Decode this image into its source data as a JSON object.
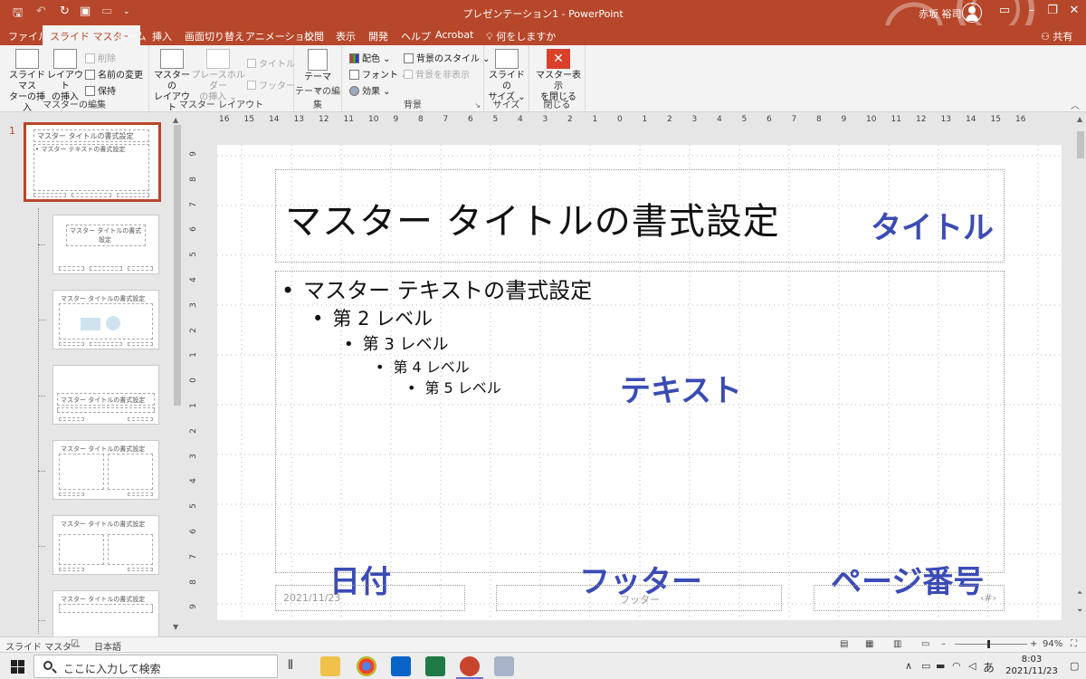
{
  "window": {
    "title": "プレゼンテーション1  -  PowerPoint",
    "user_name": "赤坂 裕司"
  },
  "tabs": [
    "ファイル",
    "スライド マスター",
    "ホーム",
    "挿入",
    "画面切り替え",
    "アニメーション",
    "校閲",
    "表示",
    "開発",
    "ヘルプ",
    "Acrobat"
  ],
  "tell_me": "何をしますか",
  "share": "共有",
  "ribbon": {
    "groups": {
      "master_edit": "マスターの編集",
      "master_layout": "マスター レイアウト",
      "theme_edit": "テーマの編集",
      "background": "背景",
      "size": "サイズ",
      "close": "閉じる"
    },
    "insert_slide_master": [
      "スライド マス",
      "ターの挿入"
    ],
    "insert_layout": [
      "レイアウト",
      "の挿入"
    ],
    "delete": "削除",
    "rename": "名前の変更",
    "preserve": "保持",
    "master_layout_btn": [
      "マスターの",
      "レイアウト"
    ],
    "insert_placeholder": [
      "プレースホルダー",
      "の挿入 ⌄"
    ],
    "title_check": "タイトル",
    "footer_check": "フッター",
    "themes": [
      "テーマ",
      "⌄"
    ],
    "colors": "配色 ⌄",
    "fonts": "フォント ⌄",
    "effects": "効果 ⌄",
    "background_styles": "背景のスタイル ⌄",
    "hide_background": "背景を非表示",
    "slide_size": [
      "スライドの",
      "サイズ ⌄"
    ],
    "close_master": [
      "マスター表示",
      "を閉じる"
    ]
  },
  "thumbnails": {
    "slide_number": "1",
    "master_title": "マスター タイトルの書式設定",
    "master_text": "• マスター テキストの書式設定",
    "layout2_title": "マスター タイトルの書式",
    "layout2_title2": "設定",
    "layout3_title": "マスター タイトルの書式設定",
    "layout4_title": "マスター タイトルの書式設定",
    "layout5_title": "マスター タイトルの書式設定",
    "layout6_title": "マスター タイトルの書式設定",
    "layout7_title": "マスター タイトルの書式設定"
  },
  "ruler": {
    "h_ticks": [
      "16",
      "15",
      "14",
      "13",
      "12",
      "11",
      "10",
      "9",
      "8",
      "7",
      "6",
      "5",
      "4",
      "3",
      "2",
      "1",
      "0",
      "1",
      "2",
      "3",
      "4",
      "5",
      "6",
      "7",
      "8",
      "9",
      "10",
      "11",
      "12",
      "13",
      "14",
      "15",
      "16"
    ],
    "v_ticks": [
      "9",
      "8",
      "7",
      "6",
      "5",
      "4",
      "3",
      "2",
      "1",
      "0",
      "1",
      "2",
      "3",
      "4",
      "5",
      "6",
      "7",
      "8",
      "9"
    ]
  },
  "slide": {
    "title": "マスター タイトルの書式設定",
    "bullets": [
      "マスター テキストの書式設定",
      "第 2 レベル",
      "第 3 レベル",
      "第 4 レベル",
      "第 5 レベル"
    ],
    "date": "2021/11/23",
    "footer": "フッター",
    "page_number": "‹#›",
    "annotations": {
      "title": "タイトル",
      "text": "テキスト",
      "date": "日付",
      "footer": "フッター",
      "page_number": "ページ番号"
    }
  },
  "statusbar": {
    "view": "スライド マスター",
    "language": "日本語",
    "zoom": "94%"
  },
  "taskbar": {
    "search_placeholder": "ここに入力して検索",
    "time": "8:03",
    "date": "2021/11/23",
    "ime": "あ"
  },
  "colors": {
    "accent": "#b7472a",
    "annotation": "#3b4bb5"
  }
}
